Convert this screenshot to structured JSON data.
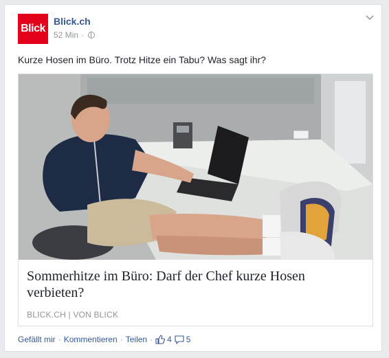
{
  "post": {
    "page_name": "Blick.ch",
    "logo_text": "Blick",
    "time": "52 Min",
    "text": "Kurze Hosen im Büro. Trotz Hitze ein Tabu? Was sagt ihr?",
    "icons": {
      "privacy": "globe-icon",
      "menu": "chevron-down-icon"
    }
  },
  "link": {
    "title": "Sommerhitze im Büro: Darf der Chef kurze Hosen verbieten?",
    "source": "BLICK.CH | VON BLICK",
    "image_description": "man in office cubicle with laptop, feet on desk"
  },
  "actions": {
    "like": "Gefällt mir",
    "comment": "Kommentieren",
    "share": "Teilen",
    "separator": "·",
    "like_count": "4",
    "comment_count": "5"
  },
  "colors": {
    "brand": "#e2001a",
    "link": "#365899",
    "muted": "#90949c",
    "text": "#1d2129"
  }
}
